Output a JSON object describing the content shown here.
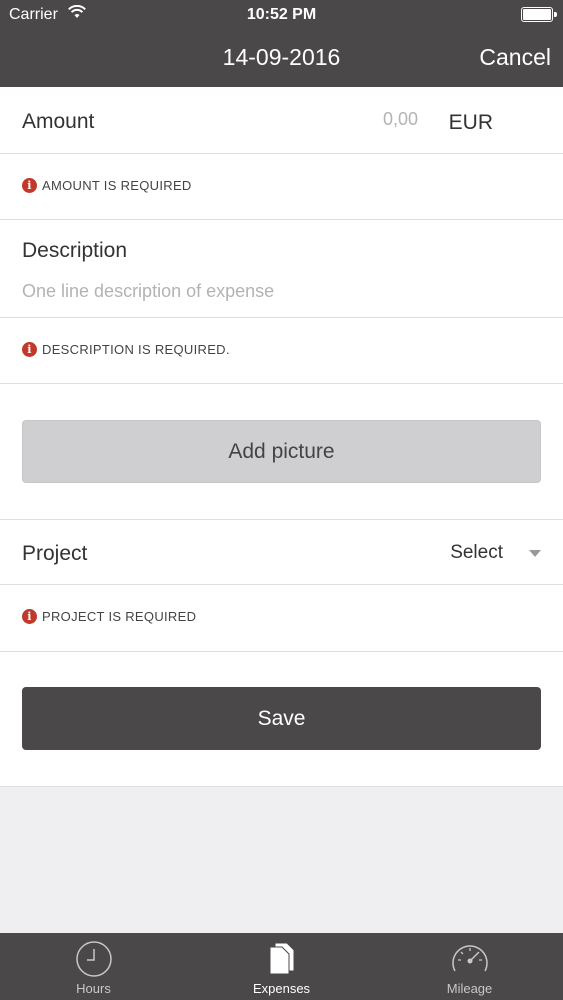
{
  "status": {
    "carrier": "Carrier",
    "time": "10:52 PM"
  },
  "nav": {
    "title": "14-09-2016",
    "cancel": "Cancel"
  },
  "form": {
    "amount": {
      "label": "Amount",
      "value": "0,00",
      "currency": "EUR",
      "error": "AMOUNT IS REQUIRED"
    },
    "description": {
      "label": "Description",
      "placeholder": "One line description of expense",
      "error": "DESCRIPTION IS REQUIRED."
    },
    "add_picture": "Add picture",
    "project": {
      "label": "Project",
      "select": "Select",
      "error": "PROJECT IS REQUIRED"
    },
    "save": "Save",
    "error_icon": "i"
  },
  "tabs": [
    {
      "label": "Hours",
      "icon": "clock-icon"
    },
    {
      "label": "Expenses",
      "icon": "document-icon"
    },
    {
      "label": "Mileage",
      "icon": "speedometer-icon"
    }
  ],
  "colors": {
    "header": "#4a4849",
    "error": "#c0392b",
    "button_gray": "#cfcfd1"
  }
}
